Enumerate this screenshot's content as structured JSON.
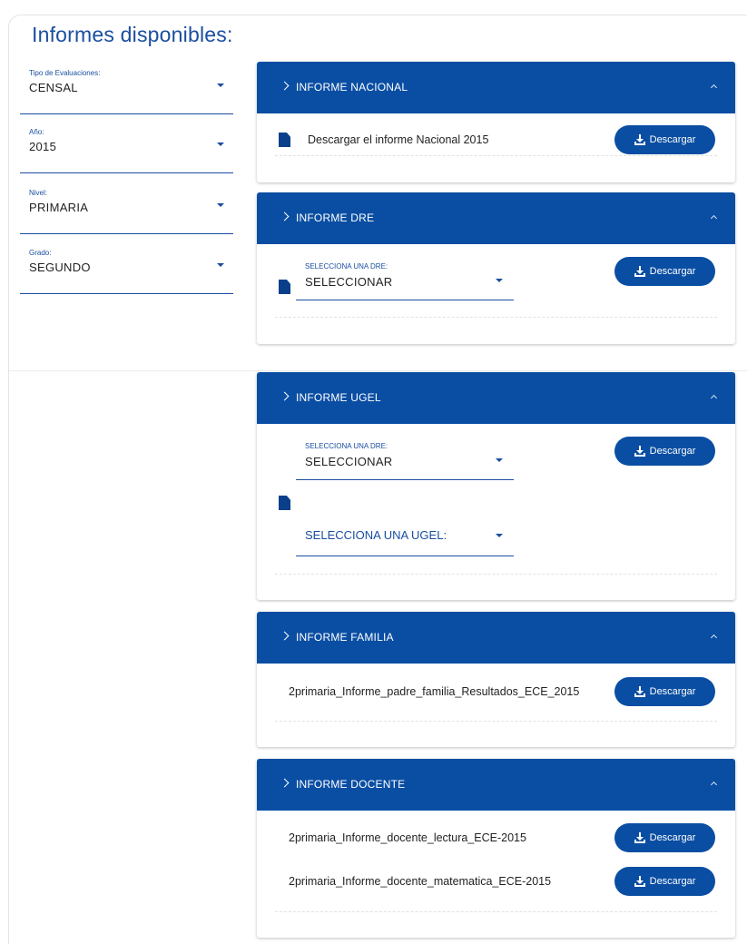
{
  "page_title": "Informes disponibles:",
  "filters": {
    "tipo": {
      "label": "Tipo de Evaluaciones:",
      "value": "CENSAL"
    },
    "anio": {
      "label": "Año:",
      "value": "2015"
    },
    "nivel": {
      "label": "Nivel:",
      "value": "PRIMARIA"
    },
    "grado": {
      "label": "Grado:",
      "value": "SEGUNDO"
    }
  },
  "download_label": "Descargar",
  "panels": {
    "nacional": {
      "title": "INFORME NACIONAL",
      "text": "Descargar el informe Nacional 2015"
    },
    "dre": {
      "title": "INFORME DRE",
      "select_label": "SELECCIONA UNA DRE:",
      "select_value": "SELECCIONAR"
    },
    "ugel": {
      "title": "INFORME UGEL",
      "dre_label": "SELECCIONA UNA DRE:",
      "dre_value": "SELECCIONAR",
      "ugel_placeholder": "SELECCIONA UNA UGEL:"
    },
    "familia": {
      "title": "INFORME FAMILIA",
      "file": "2primaria_Informe_padre_familia_Resultados_ECE_2015"
    },
    "docente": {
      "title": "INFORME DOCENTE",
      "files": [
        "2primaria_Informe_docente_lectura_ECE-2015",
        "2primaria_Informe_docente_matematica_ECE-2015"
      ]
    }
  },
  "colors": {
    "primary": "#0a4ea3",
    "accent_text": "#1a4ea0"
  },
  "icons": {
    "expand": "chevron-right-icon",
    "collapse": "chevron-up-icon",
    "download": "download-icon",
    "document": "document-icon"
  }
}
